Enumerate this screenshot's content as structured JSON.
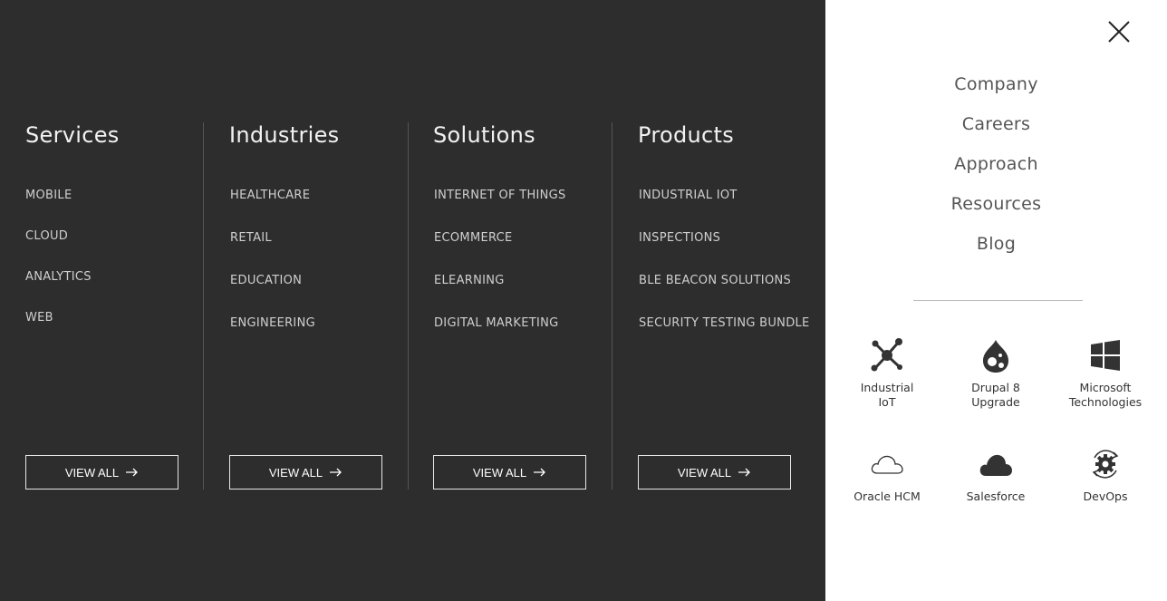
{
  "menu": {
    "columns": [
      {
        "title": "Services",
        "items": [
          "MOBILE",
          "CLOUD",
          "ANALYTICS",
          "WEB"
        ],
        "view_all": "VIEW ALL"
      },
      {
        "title": "Industries",
        "items": [
          "HEALTHCARE",
          "RETAIL",
          "EDUCATION",
          "ENGINEERING"
        ],
        "view_all": "VIEW ALL"
      },
      {
        "title": "Solutions",
        "items": [
          "INTERNET OF THINGS",
          "ECOMMERCE",
          "ELEARNING",
          "DIGITAL MARKETING"
        ],
        "view_all": "VIEW ALL"
      },
      {
        "title": "Products",
        "items": [
          "INDUSTRIAL IOT",
          "INSPECTIONS",
          "BLE BEACON SOLUTIONS",
          "SECURITY TESTING BUNDLE"
        ],
        "view_all": "VIEW ALL"
      }
    ]
  },
  "side": {
    "close_icon": "close-icon",
    "nav": [
      "Company",
      "Careers",
      "Approach",
      "Resources",
      "Blog"
    ],
    "tiles": [
      {
        "label_line1": "Industrial",
        "label_line2": "IoT",
        "icon": "iot-network-icon"
      },
      {
        "label_line1": "Drupal 8",
        "label_line2": "Upgrade",
        "icon": "drupal-icon"
      },
      {
        "label_line1": "Microsoft",
        "label_line2": "Technologies",
        "icon": "windows-icon"
      },
      {
        "label_line1": "Oracle HCM",
        "label_line2": "",
        "icon": "cloud-outline-icon"
      },
      {
        "label_line1": "Salesforce",
        "label_line2": "",
        "icon": "cloud-filled-icon"
      },
      {
        "label_line1": "DevOps",
        "label_line2": "",
        "icon": "gear-cycle-icon"
      }
    ]
  },
  "colors": {
    "dark_bg": "#2d2d2d",
    "panel_bg": "#ffffff",
    "nav_text": "#555555"
  }
}
